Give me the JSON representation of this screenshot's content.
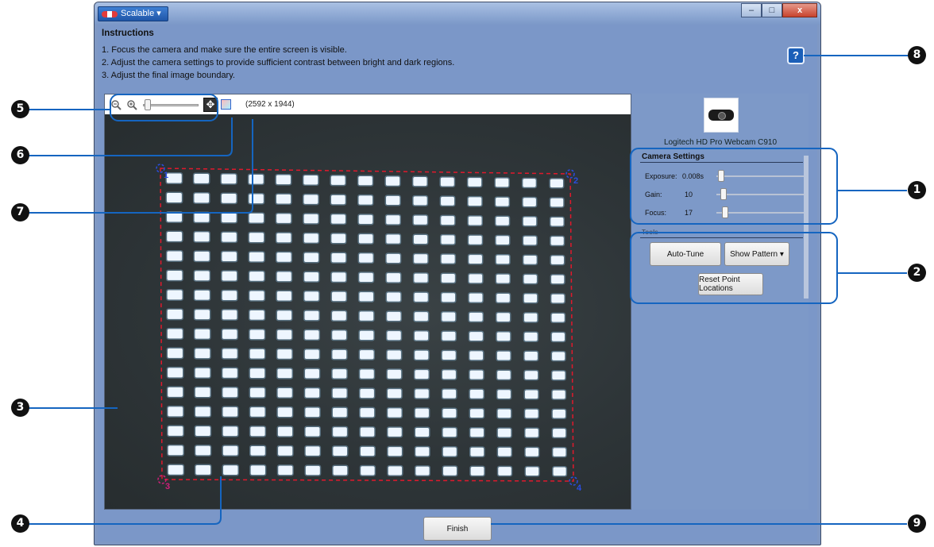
{
  "window": {
    "app_menu_label": "Scalable ▾",
    "minimize": "–",
    "maximize": "□",
    "close": "x"
  },
  "instructions": {
    "title": "Instructions",
    "steps": [
      "1. Focus the camera and make sure the entire screen is visible.",
      "2. Adjust the camera settings to provide sufficient contrast between bright and dark regions.",
      "3. Adjust the final image boundary."
    ]
  },
  "help_button": "?",
  "image_toolbar": {
    "zoom_out_icon": "zoom-out-icon",
    "zoom_in_icon": "zoom-in-icon",
    "pan_icon": "✥",
    "resolution": "(2592 x 1944)"
  },
  "camera_view": {
    "grid": {
      "rows": 16,
      "cols": 15
    },
    "corner_labels": [
      "1",
      "2",
      "3",
      "4"
    ]
  },
  "side_panel": {
    "camera_name": "Logitech HD Pro Webcam C910",
    "camera_settings_title": "Camera Settings",
    "settings": [
      {
        "label": "Exposure:",
        "value": "0.008s",
        "level": 0.02
      },
      {
        "label": "Gain:",
        "value": "10",
        "level": 0.05
      },
      {
        "label": "Focus:",
        "value": "17",
        "level": 0.07
      }
    ],
    "tools_title": "Tools",
    "auto_tune": "Auto-Tune",
    "show_pattern": "Show Pattern ▾",
    "reset_points": "Reset Point Locations"
  },
  "finish_button": "Finish",
  "callouts": [
    "1",
    "2",
    "3",
    "4",
    "5",
    "6",
    "7",
    "8",
    "9"
  ],
  "colors": {
    "callout_line": "#1565c0",
    "boundary": "#e0192c",
    "dot": "#eef6ff",
    "dot_glow": "#9fd7ff"
  }
}
